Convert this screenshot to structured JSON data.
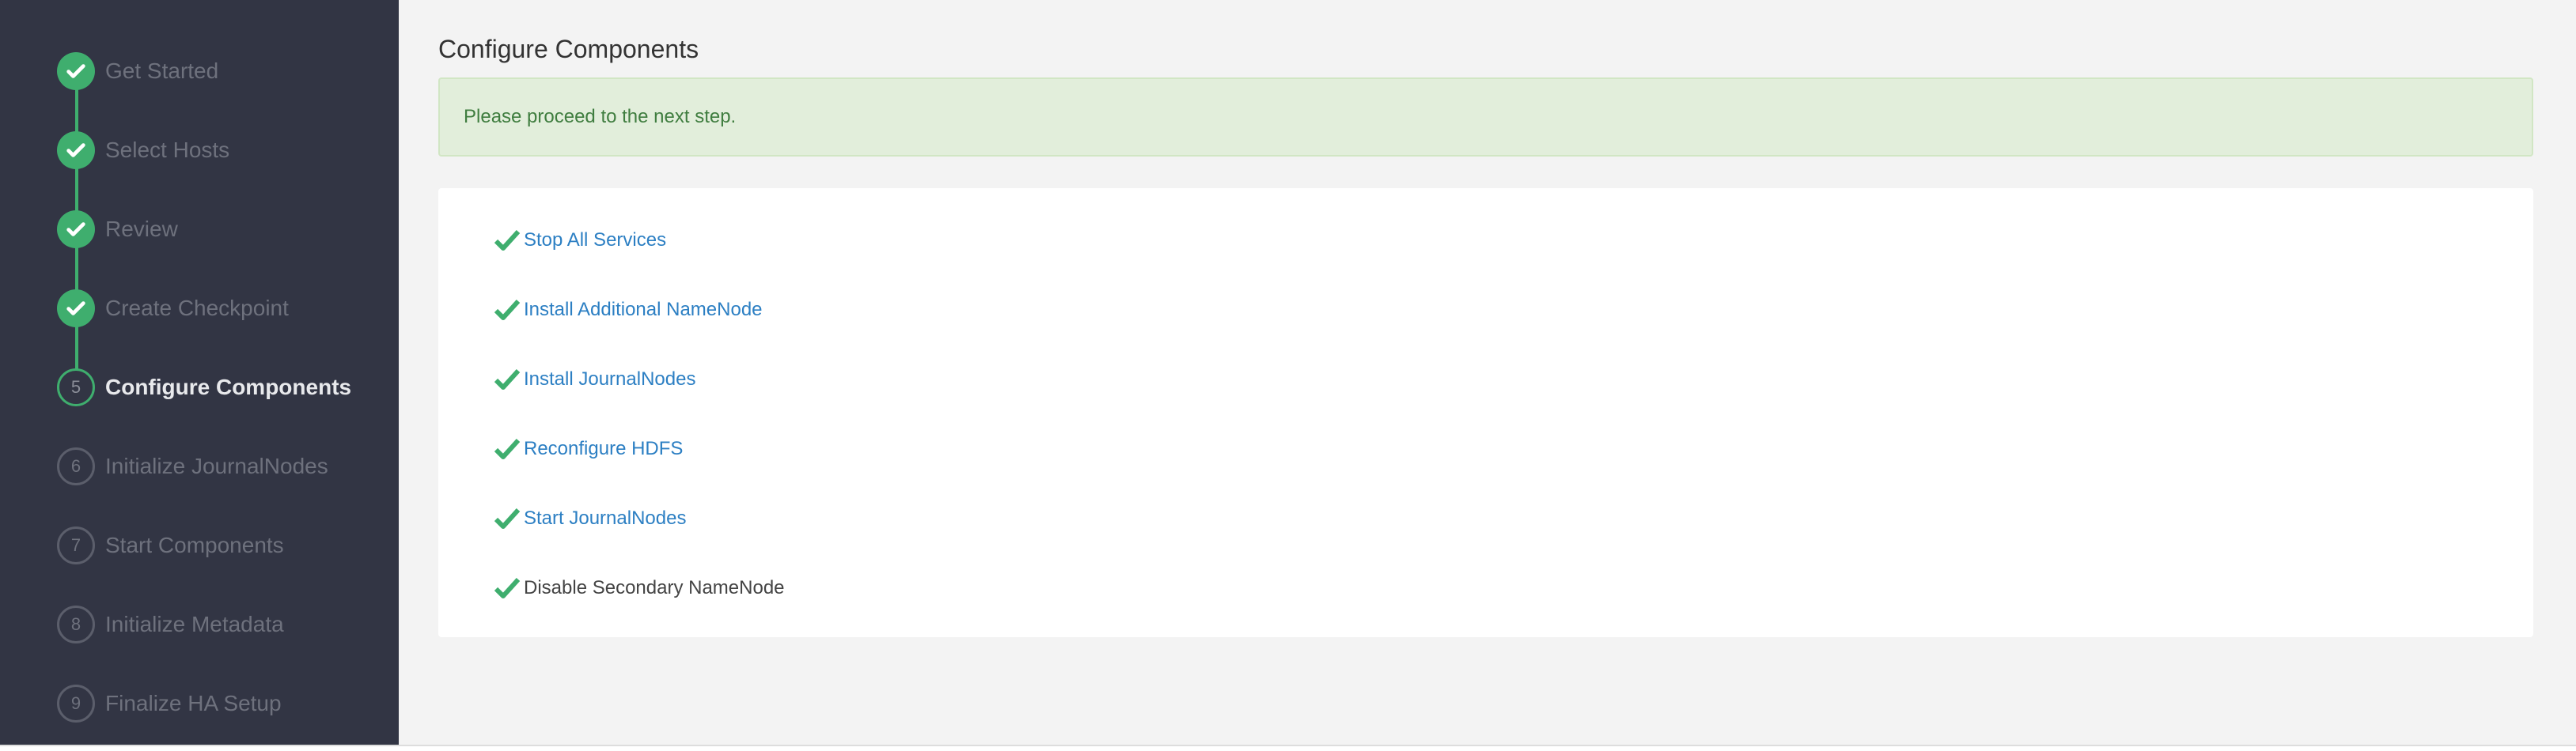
{
  "sidebar": {
    "steps": [
      {
        "label": "Get Started",
        "state": "done"
      },
      {
        "label": "Select Hosts",
        "state": "done"
      },
      {
        "label": "Review",
        "state": "done"
      },
      {
        "label": "Create Checkpoint",
        "state": "done"
      },
      {
        "label": "Configure Components",
        "state": "current",
        "number": "5"
      },
      {
        "label": "Initialize JournalNodes",
        "state": "pending",
        "number": "6"
      },
      {
        "label": "Start Components",
        "state": "pending",
        "number": "7"
      },
      {
        "label": "Initialize Metadata",
        "state": "pending",
        "number": "8"
      },
      {
        "label": "Finalize HA Setup",
        "state": "pending",
        "number": "9"
      }
    ]
  },
  "main": {
    "title": "Configure Components",
    "alert": "Please proceed to the next step.",
    "tasks": [
      {
        "label": "Stop All Services",
        "link": true,
        "status": "done"
      },
      {
        "label": "Install Additional NameNode",
        "link": true,
        "status": "done"
      },
      {
        "label": "Install JournalNodes",
        "link": true,
        "status": "done"
      },
      {
        "label": "Reconfigure HDFS",
        "link": true,
        "status": "done"
      },
      {
        "label": "Start JournalNodes",
        "link": true,
        "status": "done"
      },
      {
        "label": "Disable Secondary NameNode",
        "link": false,
        "status": "done"
      }
    ]
  },
  "colors": {
    "sidebar_bg": "#323544",
    "success": "#3fae6e",
    "link": "#2c7fc3",
    "alert_bg": "#e2eedb"
  },
  "icons": {
    "done": "checkmark-icon"
  }
}
